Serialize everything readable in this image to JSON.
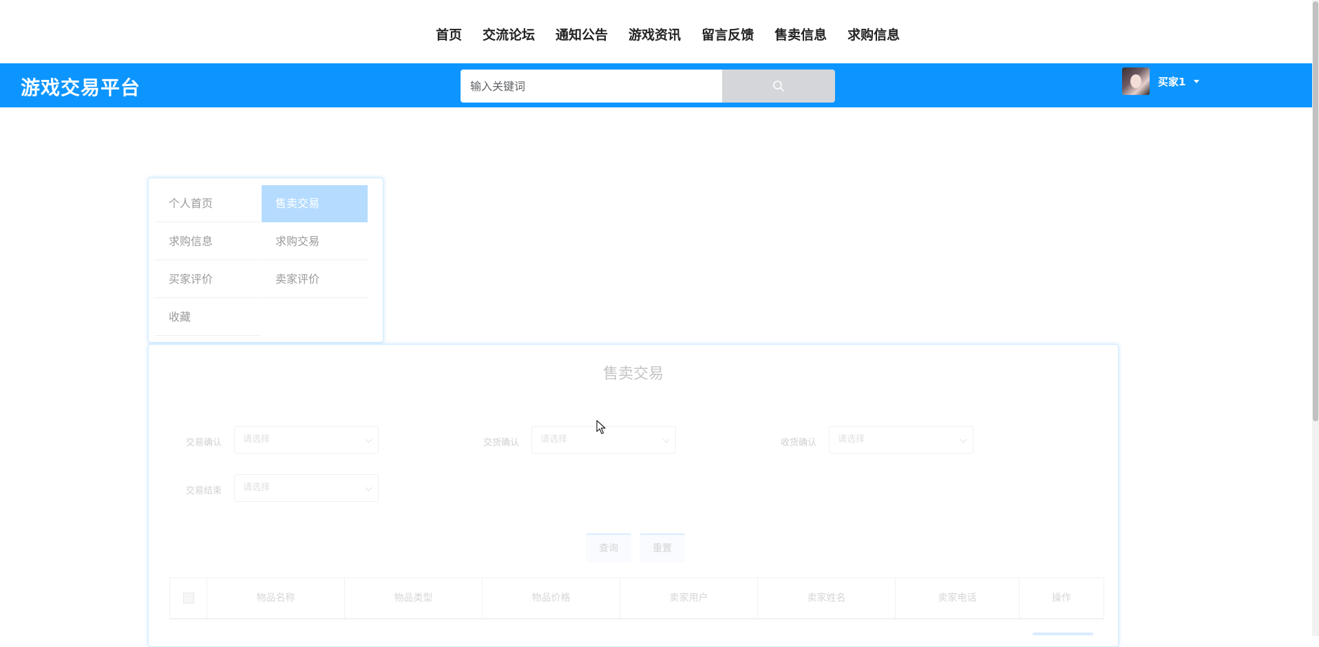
{
  "nav": {
    "items": [
      "首页",
      "交流论坛",
      "通知公告",
      "游戏资讯",
      "留言反馈",
      "售卖信息",
      "求购信息"
    ]
  },
  "header": {
    "brand": "游戏交易平台",
    "search_placeholder": "输入关键词",
    "search_icon": "search-icon",
    "username": "买家1"
  },
  "menu": {
    "items": [
      "个人首页",
      "售卖交易",
      "求购信息",
      "求购交易",
      "买家评价",
      "卖家评价",
      "收藏"
    ],
    "active": "售卖交易"
  },
  "panel": {
    "title": "售卖交易",
    "filters": [
      {
        "label": "交易确认",
        "placeholder": "请选择"
      },
      {
        "label": "交货确认",
        "placeholder": "请选择"
      },
      {
        "label": "收货确认",
        "placeholder": "请选择"
      },
      {
        "label": "交易结束",
        "placeholder": "请选择"
      }
    ],
    "buttons": {
      "query": "查询",
      "reset": "重置"
    },
    "table": {
      "columns": [
        "物品名称",
        "物品类型",
        "物品价格",
        "卖家用户",
        "卖家姓名",
        "卖家电话",
        "操作"
      ]
    }
  },
  "colors": {
    "header_bg": "#0d95ff",
    "active_menu_bg": "#b5dcff",
    "search_button_bg": "#d4d6da"
  }
}
